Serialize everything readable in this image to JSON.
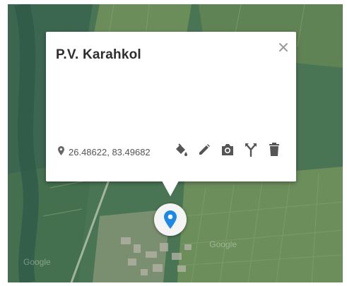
{
  "popup": {
    "title": "P.V. Karahkol",
    "coordinates": "26.48622, 83.49682"
  },
  "icons": {
    "close": "close-icon",
    "location": "location-pin-icon",
    "style": "paint-bucket-icon",
    "edit": "pencil-icon",
    "photo": "camera-icon",
    "directions": "fork-directions-icon",
    "delete": "trash-icon",
    "marker": "map-marker-icon"
  },
  "colors": {
    "marker": "#1e88e5",
    "icon": "#555555",
    "title": "#2e2e2e"
  },
  "map": {
    "watermark_right": "Google",
    "watermark_left": "Google"
  }
}
